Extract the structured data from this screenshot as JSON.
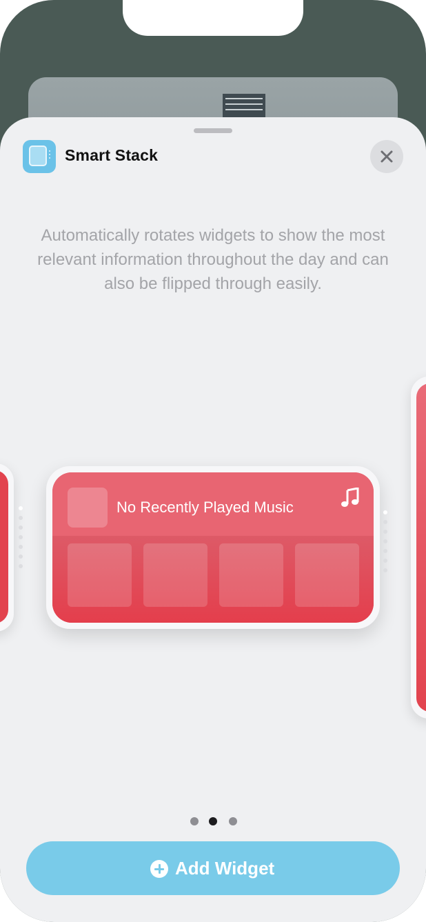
{
  "widget_sheet": {
    "title": "Smart Stack",
    "description": "Automatically rotates widgets to show the most relevant information throughout the day and can also be flipped through easily.",
    "close_icon": "close-icon",
    "app_icon": "smart-stack-icon"
  },
  "preview": {
    "music_widget": {
      "label": "No Recently Played Music",
      "icon": "music-note-icon",
      "accent_color": "#E8505E"
    }
  },
  "pager": {
    "pages": 3,
    "selected_index": 1
  },
  "add_button": {
    "label": "Add Widget",
    "icon": "plus-circle-icon",
    "color": "#79CBE9"
  }
}
